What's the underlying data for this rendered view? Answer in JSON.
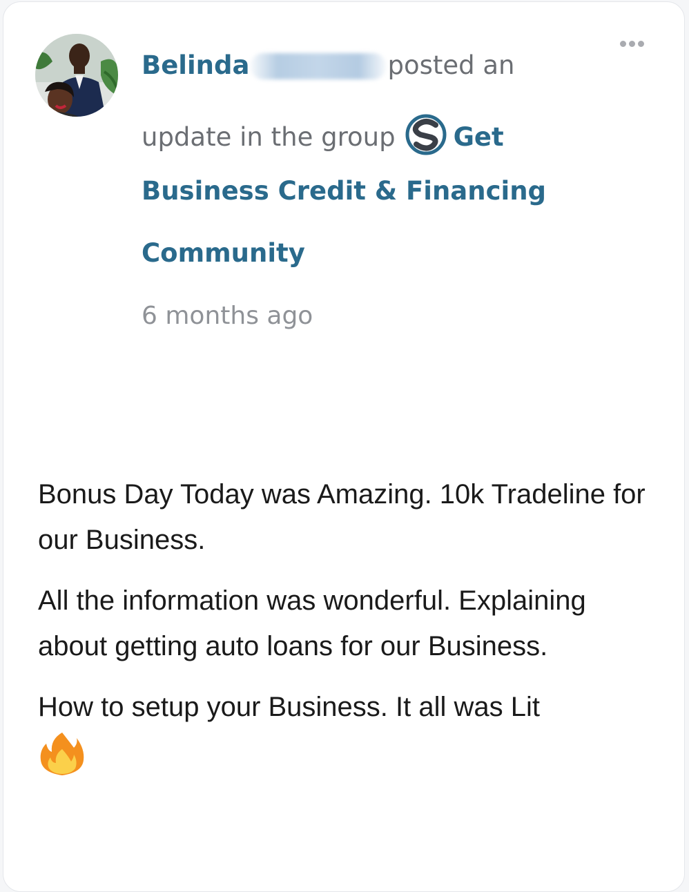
{
  "post": {
    "author_first_name": "Belinda",
    "action_text": "posted an",
    "action_text_2": "update in the group",
    "group_name_part1": "Get",
    "group_name_part2": "Business Credit & Financing",
    "group_name_part3": "Community",
    "timestamp": "6 months ago",
    "paragraphs": [
      "Bonus Day Today was Amazing. 10k Tradeline for our Business.",
      "All the information was wonderful. Explaining about getting auto loans for our Business.",
      "How to setup your Business. It all was Lit"
    ],
    "emoji": "fire-emoji"
  },
  "icons": {
    "avatar": "avatar-photo",
    "group": "group-logo-icon",
    "more": "more-options-icon"
  },
  "colors": {
    "link": "#2a6a8c",
    "muted": "#6b6e73",
    "timestamp": "#8f9297",
    "body_text": "#1a1a1a"
  }
}
